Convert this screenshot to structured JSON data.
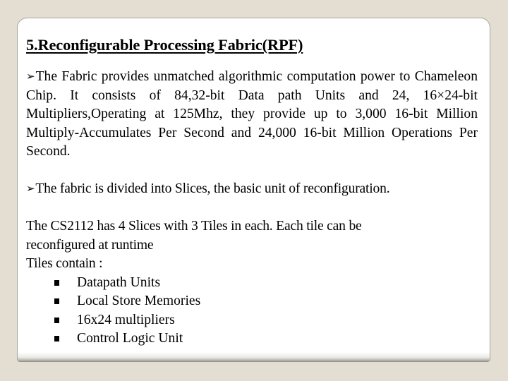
{
  "slide": {
    "title": "5.Reconfigurable Processing Fabric(RPF)",
    "paragraph1": {
      "bullet_icon": "arrow-bullet-icon",
      "text": "The Fabric provides unmatched algorithmic computation power to Chameleon Chip. It consists of 84,32-bit Data path Units and 24, 16×24-bit Multipliers,Operating at 125Mhz, they provide up to 3,000 16-bit Million Multiply-Accumulates Per Second and 24,000 16-bit Million Operations Per Second."
    },
    "paragraph2": {
      "bullet_icon": "arrow-bullet-icon",
      "text": "The fabric is divided into Slices, the basic unit of reconfiguration."
    },
    "paragraph3": {
      "line1": "The  CS2112 has  4 Slices with 3 Tiles in each. Each tile can be",
      "line2": "reconfigured at runtime",
      "line3": "Tiles contain :"
    },
    "tile_contents": [
      "Datapath Units",
      "Local Store Memories",
      "16x24 multipliers",
      "Control Logic Unit"
    ]
  },
  "colors": {
    "background": "#e3ddd2",
    "card": "#ffffff",
    "text": "#000000",
    "border": "#a8a59e"
  }
}
